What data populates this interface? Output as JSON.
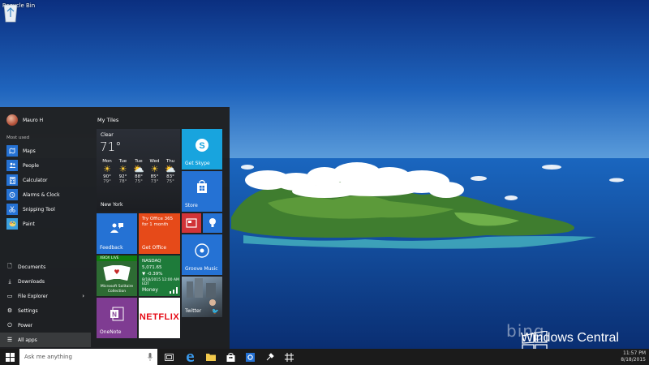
{
  "desktop": {
    "recycle_bin_label": "Recycle Bin"
  },
  "watermark": {
    "bing_text": "bing",
    "brand_text": "Windows Central"
  },
  "start_menu": {
    "user_name": "Mauro H",
    "most_used_label": "Most used",
    "most_used": [
      {
        "label": "Maps",
        "icon": "map-icon"
      },
      {
        "label": "People",
        "icon": "people-icon"
      },
      {
        "label": "Calculator",
        "icon": "calculator-icon"
      },
      {
        "label": "Alarms & Clock",
        "icon": "alarm-icon"
      },
      {
        "label": "Snipping Tool",
        "icon": "scissors-icon"
      },
      {
        "label": "Paint",
        "icon": "paint-icon"
      }
    ],
    "system": [
      {
        "label": "Documents",
        "icon": "document-icon"
      },
      {
        "label": "Downloads",
        "icon": "download-icon"
      },
      {
        "label": "File Explorer",
        "icon": "folder-icon"
      },
      {
        "label": "Settings",
        "icon": "gear-icon"
      },
      {
        "label": "Power",
        "icon": "power-icon"
      },
      {
        "label": "All apps",
        "icon": "list-icon"
      }
    ],
    "tiles_header": "My Tiles",
    "tiles": {
      "weather": {
        "condition": "Clear",
        "temp": "71°",
        "city": "New York",
        "days": [
          {
            "name": "Mon",
            "hi": "90°",
            "lo": "79°"
          },
          {
            "name": "Tue",
            "hi": "92°",
            "lo": "78°"
          },
          {
            "name": "Tue",
            "hi": "88°",
            "lo": "75°"
          },
          {
            "name": "Wed",
            "hi": "85°",
            "lo": "73°"
          },
          {
            "name": "Thu",
            "hi": "83°",
            "lo": "75°"
          }
        ]
      },
      "skype": "Get Skype",
      "store": "Store",
      "feedback": "Feedback",
      "office_promo": "Try Office 365 for 1 month",
      "office_label": "Get Office",
      "groove": "Groove Music",
      "xbox_badge": "XBOX LIVE",
      "solitaire": "Microsoft Solitaire Collection",
      "money": {
        "index": "NASDAQ",
        "value": "5,071.65",
        "change": "▼ -0.39%",
        "date": "8/18/2015 12:00 AM EDT",
        "label": "Money"
      },
      "twitter": "Twitter",
      "onenote": "OneNote",
      "netflix": "NETFLIX"
    }
  },
  "taskbar": {
    "search_placeholder": "Ask me anything",
    "time": "11:57 PM",
    "date": "8/18/2015"
  },
  "colors": {
    "accent": "#2572d4",
    "taskbar": "#1b1b1b",
    "start_bg": "#1f1f1f"
  }
}
